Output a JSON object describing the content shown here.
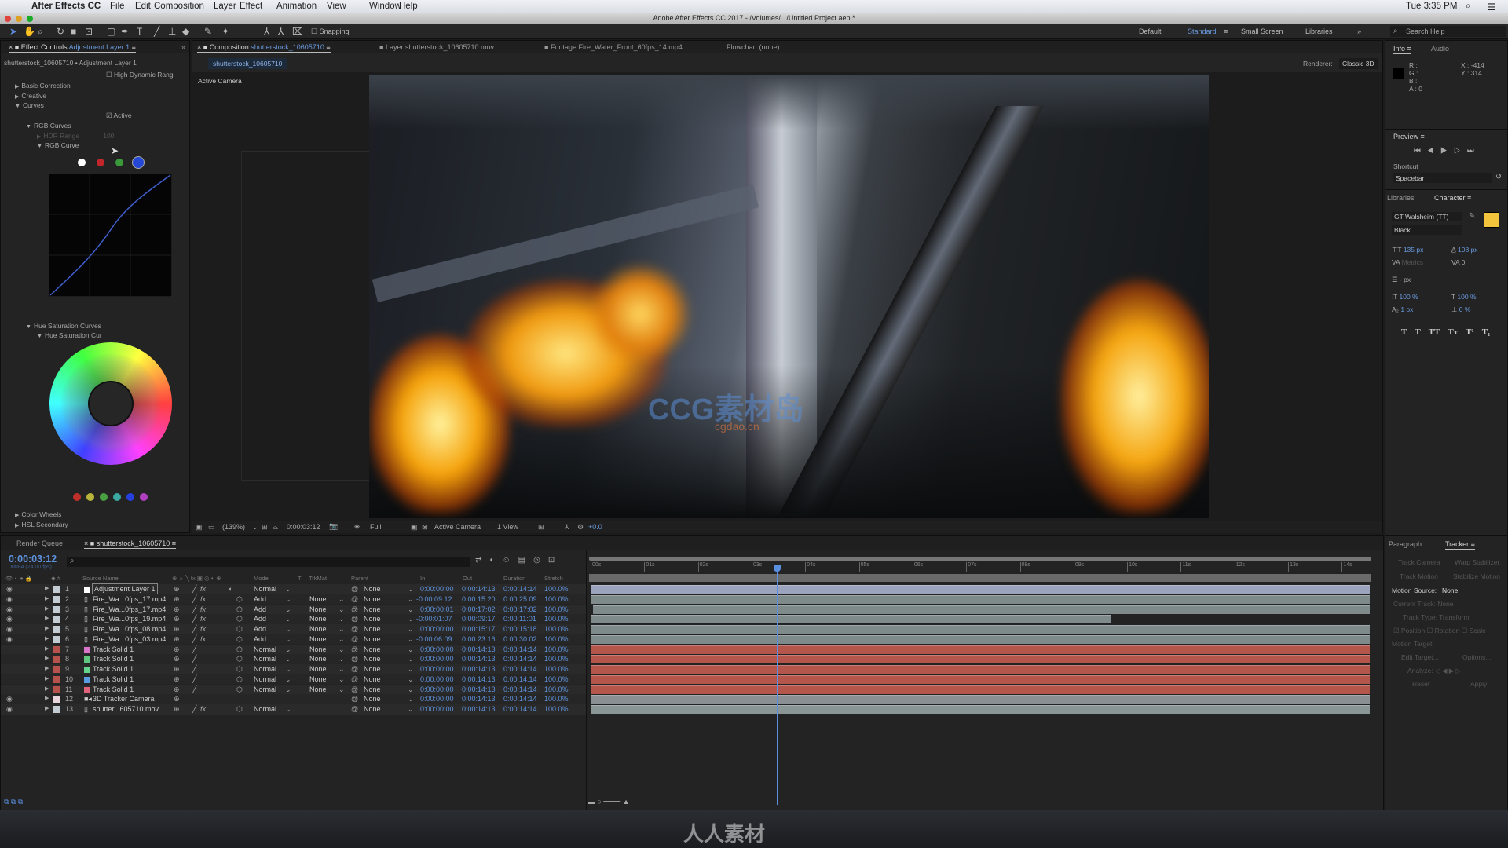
{
  "menubar": {
    "app": "After Effects CC",
    "items": [
      "File",
      "Edit",
      "Composition",
      "Layer",
      "Effect",
      "Animation",
      "View",
      "Window",
      "Help"
    ],
    "clock": "Tue 3:35 PM"
  },
  "titlebar": {
    "title": "Adobe After Effects CC 2017 - /Volumes/.../Untitled Project.aep *"
  },
  "toolbar": {
    "snapping": "Snapping",
    "workspaces": [
      "Default",
      "Standard",
      "Small Screen",
      "Libraries"
    ],
    "active_workspace": "Standard",
    "search_placeholder": "Search Help"
  },
  "effect_controls": {
    "tab": "Effect Controls",
    "tab_target": "Adjustment Layer 1",
    "breadcrumb": "shutterstock_10605710 • Adjustment Layer 1",
    "hdr_label": "High Dynamic Rang",
    "sections": [
      "Basic Correction",
      "Creative",
      "Curves"
    ],
    "active_label": "Active",
    "rgb_curves": "RGB Curves",
    "hdr_range": "HDR Range",
    "hdr_value": "100",
    "rgb_curve": "RGB Curve",
    "hue_sat_curves": "Hue Saturation Curves",
    "hue_sat_curve": "Hue Saturation Cur",
    "channel_dots": [
      "#ffffff",
      "#c0262a",
      "#3a9a3a",
      "#2447d6"
    ],
    "hue_dots": [
      "#c0302a",
      "#b8b43a",
      "#4aa040",
      "#3aa7a0",
      "#2640e0",
      "#b040c0"
    ],
    "collapsed": [
      "Color Wheels",
      "HSL Secondary"
    ]
  },
  "composition": {
    "tabs": [
      {
        "prefix": "Composition",
        "name": "shutterstock_10605710"
      },
      {
        "prefix": "Layer",
        "name": "shutterstock_10605710.mov"
      },
      {
        "prefix": "Footage",
        "name": "Fire_Water_Front_60fps_14.mp4"
      },
      {
        "prefix": "Flowchart",
        "name": "(none)"
      }
    ],
    "subtab": "shutterstock_10605710",
    "view_label": "Active Camera",
    "renderer_label": "Renderer:",
    "renderer": "Classic 3D",
    "footer": {
      "zoom": "(139%)",
      "timecode": "0:00:03:12",
      "resolution": "Full",
      "camera": "Active Camera",
      "views": "1 View",
      "exposure": "+0.0"
    },
    "watermark": "CG素材岛",
    "watermark_sub": "cgdao.cn"
  },
  "info": {
    "tab": "Info",
    "tab2": "Audio",
    "r": "R :",
    "g": "G :",
    "b": "B :",
    "a": "A : 0",
    "x": "X : -414",
    "y": "Y : 314"
  },
  "preview": {
    "title": "Preview",
    "shortcut_label": "Shortcut",
    "shortcut": "Spacebar"
  },
  "character": {
    "tab_left": "Libraries",
    "tab": "Character",
    "font": "GT Walsheim (TT)",
    "style": "Black",
    "size": "135 px",
    "leading": "108 px",
    "kerning": "Metrics",
    "tracking": "0",
    "stroke": "- px",
    "vscale": "100 %",
    "hscale": "100 %",
    "baseline": "1 px",
    "tsume": "0 %",
    "fill_color": "#f2c53d",
    "styles": [
      "T",
      "T",
      "TT",
      "Tт",
      "T¹",
      "T₁"
    ]
  },
  "tracker": {
    "tab_left": "Paragraph",
    "tab": "Tracker",
    "buttons": [
      "Track Camera",
      "Warp Stabilizer",
      "Track Motion",
      "Stabilize Motion"
    ],
    "motion_source_label": "Motion Source:",
    "motion_source": "None",
    "current_track": "Current Track: None",
    "track_type": "Track Type: Transform",
    "checks": [
      "Position",
      "Rotation",
      "Scale"
    ],
    "motion_target": "Motion Target:",
    "edit_target": "Edit Target...",
    "options": "Options...",
    "analyze": "Analyze:",
    "reset": "Reset",
    "apply": "Apply"
  },
  "timeline": {
    "tab_render": "Render Queue",
    "tab_comp": "shutterstock_10605710",
    "timecode": "0:00:03:12",
    "fps": "00084 (24.00 fps)",
    "columns": {
      "source": "Source Name",
      "mode": "Mode",
      "t": "T",
      "trkmat": "TrkMat",
      "parent": "Parent",
      "in": "In",
      "out": "Out",
      "duration": "Duration",
      "stretch": "Stretch"
    },
    "ruler": [
      "00s",
      "01s",
      "02s",
      "03s",
      "04s",
      "05s",
      "06s",
      "07s",
      "08s",
      "09s",
      "10s",
      "11s",
      "12s",
      "13s",
      "14s"
    ],
    "comp_duration_s": 14.58,
    "current_time_s": 3.5,
    "layers": [
      {
        "num": "1",
        "name": "Adjustment Layer 1",
        "label": "#c3ccd2",
        "src": "#ffffff",
        "icon": "solid",
        "mode": "Normal",
        "trkmat": "",
        "parent": "None",
        "in": "0:00:00:00",
        "out": "0:00:14:13",
        "duration": "0:00:14:14",
        "stretch": "100.0%",
        "visible": true,
        "fx": true,
        "bar": "#9ca4bd"
      },
      {
        "num": "2",
        "name": "Fire_Wa...0fps_17.mp4",
        "label": "#c3ccd2",
        "src": "",
        "icon": "file",
        "mode": "Add",
        "trkmat": "None",
        "parent": "None",
        "in": "-0:00:09:12",
        "out": "0:00:15:20",
        "duration": "0:00:25:09",
        "stretch": "100.0%",
        "visible": true,
        "fx": true,
        "bar": "#7f8b8b"
      },
      {
        "num": "3",
        "name": "Fire_Wa...0fps_17.mp4",
        "label": "#c3ccd2",
        "src": "",
        "icon": "file",
        "mode": "Add",
        "trkmat": "None",
        "parent": "None",
        "in": "0:00:00:01",
        "out": "0:00:17:02",
        "duration": "0:00:17:02",
        "stretch": "100.0%",
        "visible": true,
        "fx": true,
        "bar": "#7f8b8b"
      },
      {
        "num": "4",
        "name": "Fire_Wa...0fps_19.mp4",
        "label": "#c3ccd2",
        "src": "",
        "icon": "file",
        "mode": "Add",
        "trkmat": "None",
        "parent": "None",
        "in": "-0:00:01:07",
        "out": "0:00:09:17",
        "duration": "0:00:11:01",
        "stretch": "100.0%",
        "visible": true,
        "fx": true,
        "bar": "#7f8b8b"
      },
      {
        "num": "5",
        "name": "Fire_Wa...0fps_08.mp4",
        "label": "#c3ccd2",
        "src": "",
        "icon": "file",
        "mode": "Add",
        "trkmat": "None",
        "parent": "None",
        "in": "0:00:00:00",
        "out": "0:00:15:17",
        "duration": "0:00:15:18",
        "stretch": "100.0%",
        "visible": true,
        "fx": true,
        "bar": "#7f8b8b"
      },
      {
        "num": "6",
        "name": "Fire_Wa...0fps_03.mp4",
        "label": "#c3ccd2",
        "src": "",
        "icon": "file",
        "mode": "Add",
        "trkmat": "None",
        "parent": "None",
        "in": "-0:00:06:09",
        "out": "0:00:23:16",
        "duration": "0:00:30:02",
        "stretch": "100.0%",
        "visible": true,
        "fx": true,
        "bar": "#7f8b8b"
      },
      {
        "num": "7",
        "name": "Track Solid 1",
        "label": "#b5524b",
        "src": "#d874c9",
        "icon": "solid",
        "mode": "Normal",
        "trkmat": "None",
        "parent": "None",
        "in": "0:00:00:00",
        "out": "0:00:14:13",
        "duration": "0:00:14:14",
        "stretch": "100.0%",
        "visible": false,
        "fx": false,
        "bar": "#b5564c"
      },
      {
        "num": "8",
        "name": "Track Solid 1",
        "label": "#b5524b",
        "src": "#5fc77f",
        "icon": "solid",
        "mode": "Normal",
        "trkmat": "None",
        "parent": "None",
        "in": "0:00:00:00",
        "out": "0:00:14:13",
        "duration": "0:00:14:14",
        "stretch": "100.0%",
        "visible": false,
        "fx": false,
        "bar": "#b5564c"
      },
      {
        "num": "9",
        "name": "Track Solid 1",
        "label": "#b5524b",
        "src": "#64d38c",
        "icon": "solid",
        "mode": "Normal",
        "trkmat": "None",
        "parent": "None",
        "in": "0:00:00:00",
        "out": "0:00:14:13",
        "duration": "0:00:14:14",
        "stretch": "100.0%",
        "visible": false,
        "fx": false,
        "bar": "#b5564c"
      },
      {
        "num": "10",
        "name": "Track Solid 1",
        "label": "#b5524b",
        "src": "#5b9be0",
        "icon": "solid",
        "mode": "Normal",
        "trkmat": "None",
        "parent": "None",
        "in": "0:00:00:00",
        "out": "0:00:14:13",
        "duration": "0:00:14:14",
        "stretch": "100.0%",
        "visible": false,
        "fx": false,
        "bar": "#b5564c"
      },
      {
        "num": "11",
        "name": "Track Solid 1",
        "label": "#b5524b",
        "src": "#e0637c",
        "icon": "solid",
        "mode": "Normal",
        "trkmat": "None",
        "parent": "None",
        "in": "0:00:00:00",
        "out": "0:00:14:13",
        "duration": "0:00:14:14",
        "stretch": "100.0%",
        "visible": false,
        "fx": false,
        "bar": "#b5564c"
      },
      {
        "num": "12",
        "name": "3D Tracker Camera",
        "label": "#e8d6dc",
        "src": "",
        "icon": "camera",
        "mode": "",
        "trkmat": "",
        "parent": "None",
        "in": "0:00:00:00",
        "out": "0:00:14:13",
        "duration": "0:00:14:14",
        "stretch": "100.0%",
        "visible": true,
        "fx": false,
        "bar": "#8a8f94"
      },
      {
        "num": "13",
        "name": "shutter...605710.mov",
        "label": "#c3ccd2",
        "src": "",
        "icon": "file",
        "mode": "Normal",
        "trkmat": "",
        "parent": "None",
        "in": "0:00:00:00",
        "out": "0:00:14:13",
        "duration": "0:00:14:14",
        "stretch": "100.0%",
        "visible": true,
        "fx": true,
        "bar": "#8a9696"
      }
    ]
  },
  "bottom_watermark": "人人素材"
}
